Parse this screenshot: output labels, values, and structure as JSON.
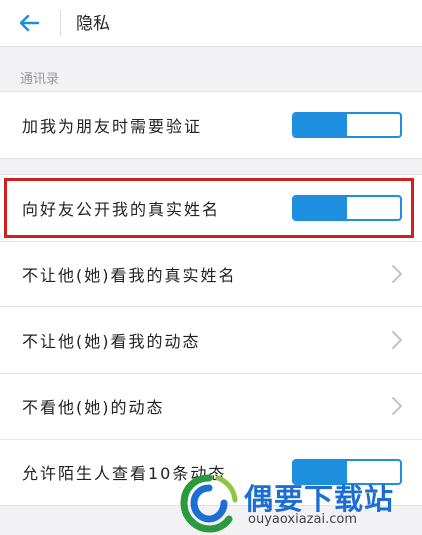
{
  "header": {
    "title": "隐私",
    "back_icon": "arrow-left-icon"
  },
  "section": {
    "label": "通讯录"
  },
  "groups": [
    {
      "rows": [
        {
          "label": "加我为朋友时需要验证",
          "control": "toggle",
          "on": true
        }
      ]
    },
    {
      "rows": [
        {
          "label": "向好友公开我的真实姓名",
          "control": "toggle",
          "on": true,
          "highlighted": true
        },
        {
          "label": "不让他(她)看我的真实姓名",
          "control": "chevron"
        }
      ]
    },
    {
      "rows": [
        {
          "label": "不让他(她)看我的动态",
          "control": "chevron"
        },
        {
          "label": "不看他(她)的动态",
          "control": "chevron"
        },
        {
          "label": "允许陌生人查看10条动态",
          "control": "toggle",
          "on": true
        }
      ]
    }
  ],
  "watermark": {
    "name": "偶要下载站",
    "domain": "ouyaoxiazai.com"
  },
  "colors": {
    "accent": "#1e8fde",
    "highlight": "#d21f1f",
    "background": "#f2f2f4",
    "watermark": "#1c6ed3"
  }
}
